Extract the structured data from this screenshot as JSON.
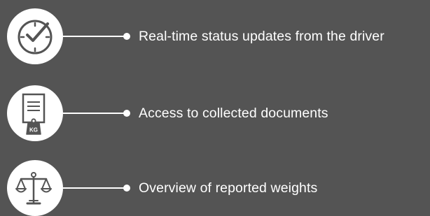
{
  "theme": {
    "background": "#545454",
    "foreground": "#ffffff",
    "icon_stroke": "#545454"
  },
  "features": [
    {
      "icon": "clock-check-icon",
      "text": "Real-time status updates from the driver"
    },
    {
      "icon": "document-weight-icon",
      "text": "Access to collected documents",
      "icon_label": "KG"
    },
    {
      "icon": "balance-scale-icon",
      "text": "Overview of reported weights"
    }
  ]
}
